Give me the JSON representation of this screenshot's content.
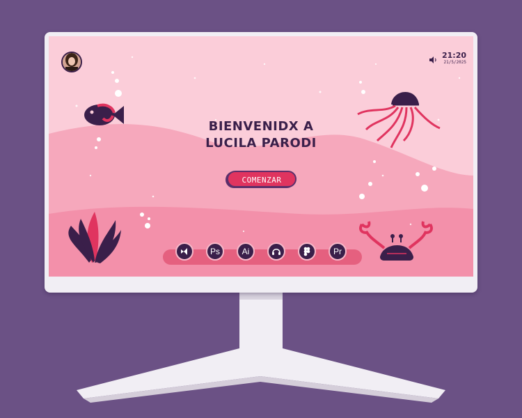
{
  "welcome": {
    "line1": "BIENVENIDX A",
    "line2": "LUCILA PARODI"
  },
  "start_button": {
    "label": "COMENZAR"
  },
  "status": {
    "time": "21:20",
    "date": "21/5/2025"
  },
  "dock": {
    "items": [
      {
        "label": "",
        "icon": "visual-studio-icon"
      },
      {
        "label": "Ps",
        "icon": "photoshop-icon"
      },
      {
        "label": "Ai",
        "icon": "illustrator-icon"
      },
      {
        "label": "",
        "icon": "headphones-icon"
      },
      {
        "label": "",
        "icon": "figma-icon"
      },
      {
        "label": "Pr",
        "icon": "premiere-icon"
      }
    ]
  },
  "colors": {
    "background": "#6b5185",
    "screen_pink": "#f7b9c9",
    "accent": "#e0345f",
    "dark": "#3a1f4a"
  }
}
